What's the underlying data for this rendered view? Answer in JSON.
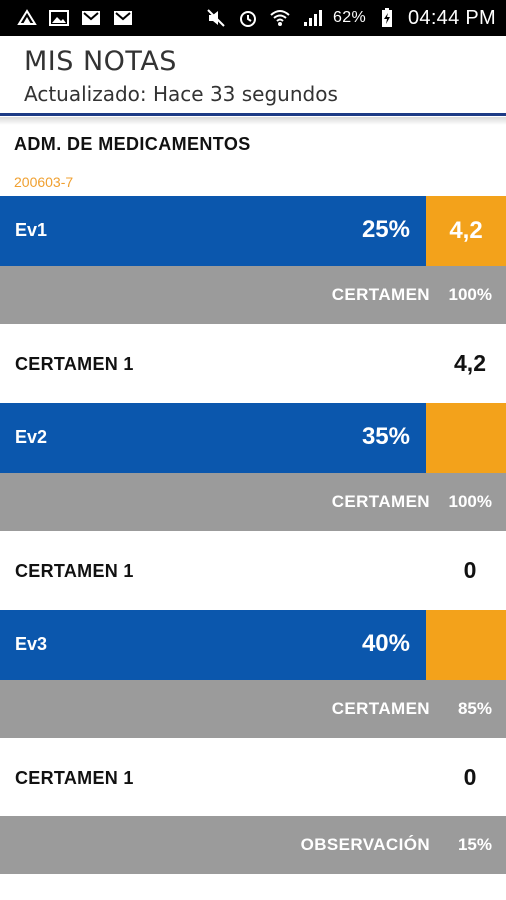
{
  "status_bar": {
    "left_icons": [
      "recycle-icon",
      "image-icon",
      "gmail-icon",
      "gmail-icon"
    ],
    "right_icons": [
      "mute-icon",
      "alarm-icon",
      "wifi-icon",
      "signal-icon",
      "battery-icon"
    ],
    "battery": "62%",
    "time": "04:44 PM"
  },
  "header": {
    "title": "MIS NOTAS",
    "subtitle": "Actualizado: Hace 33 segundos"
  },
  "course": {
    "name": "ADM. DE MEDICAMENTOS",
    "code": "200603-7"
  },
  "evaluations": [
    {
      "name": "Ev1",
      "weight": "25%",
      "grade": "4,2",
      "type_label": "CERTAMEN",
      "type_weight": "100%",
      "items": [
        {
          "name": "CERTAMEN 1",
          "grade": "4,2"
        }
      ]
    },
    {
      "name": "Ev2",
      "weight": "35%",
      "grade": "",
      "type_label": "CERTAMEN",
      "type_weight": "100%",
      "items": [
        {
          "name": "CERTAMEN 1",
          "grade": "0"
        }
      ]
    },
    {
      "name": "Ev3",
      "weight": "40%",
      "grade": "",
      "type_label": "CERTAMEN",
      "type_weight": "85%",
      "items": [
        {
          "name": "CERTAMEN 1",
          "grade": "0"
        }
      ],
      "extra_label": "OBSERVACIÓN",
      "extra_weight": "15%"
    }
  ],
  "colors": {
    "evaluation_bar": "#0b57ad",
    "grade_box": "#f3a21b",
    "type_bar": "#9b9b9b",
    "header_border": "#1d3b86",
    "course_code": "#f0a030"
  }
}
